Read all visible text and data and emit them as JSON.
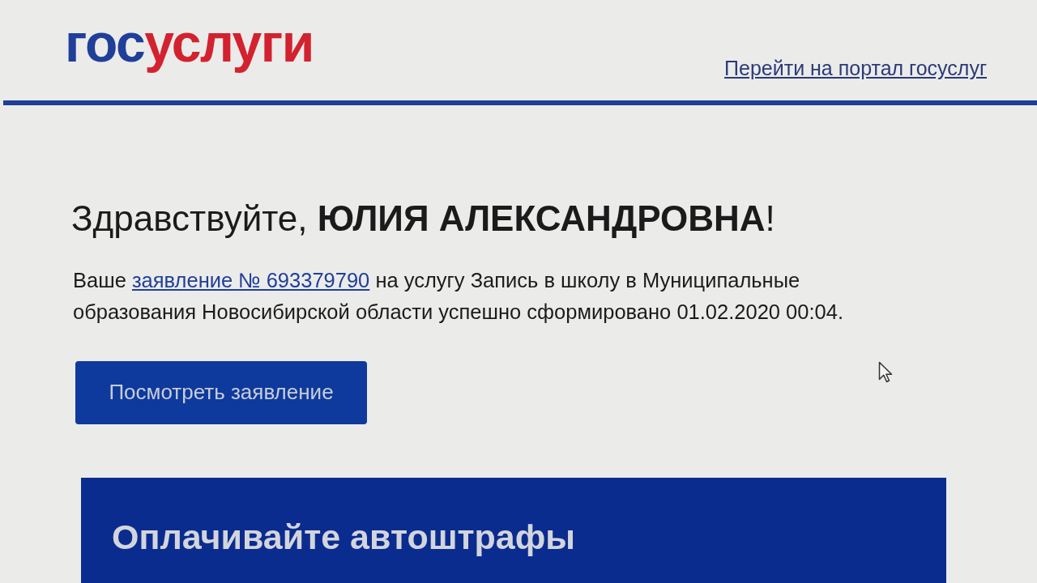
{
  "header": {
    "logo": [
      {
        "text": "гос",
        "color": "#1f3f98"
      },
      {
        "text": "услуги",
        "color": "#d3222f"
      }
    ],
    "portal_link": "Перейти на портал госуслуг"
  },
  "message": {
    "greeting": "Здравствуйте, **ЮЛИЯ АЛЕКСАНДРОВНА**!",
    "text_before": "Ваше",
    "application_link": "заявление № 693379790",
    "text_after": "на услугу Запись в школу в Муниципальные образования Новосибирской области успешно сформировано 01.02.2020 00:04.",
    "button": "Посмотреть заявление"
  },
  "promo": {
    "title": "Оплачивайте автоштрафы"
  }
}
